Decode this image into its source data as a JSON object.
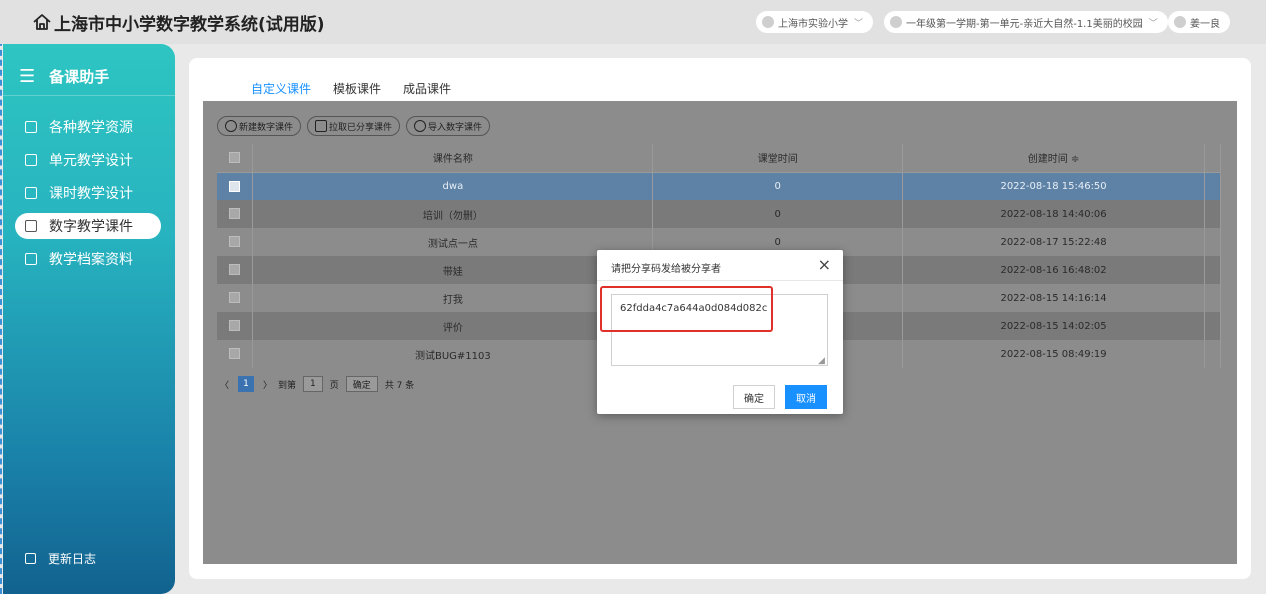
{
  "header": {
    "app_title": "上海市中小学数字教学系统(试用版)",
    "school": "上海市实验小学",
    "course": "一年级第一学期-第一单元-亲近大自然-1.1美丽的校园",
    "user": "姜一良"
  },
  "sidebar": {
    "title": "备课助手",
    "items": [
      {
        "label": "各种教学资源",
        "icon": "resource-icon"
      },
      {
        "label": "单元教学设计",
        "icon": "unit-icon"
      },
      {
        "label": "课时教学设计",
        "icon": "lesson-icon"
      },
      {
        "label": "数字教学课件",
        "icon": "courseware-icon",
        "active": true
      },
      {
        "label": "教学档案资料",
        "icon": "archive-icon"
      }
    ],
    "footer": "更新日志"
  },
  "tabs": [
    {
      "label": "自定义课件",
      "active": true
    },
    {
      "label": "模板课件"
    },
    {
      "label": "成品课件"
    }
  ],
  "toolbar": {
    "new_label": "新建数字课件",
    "pull_label": "拉取已分享课件",
    "import_label": "导入数字课件"
  },
  "table": {
    "headers": [
      "课件名称",
      "课堂时间",
      "创建时间 ≑"
    ],
    "rows": [
      {
        "name": "dwa",
        "time": "0",
        "created": "2022-08-18 15:46:50"
      },
      {
        "name": "培训（勿删）",
        "time": "0",
        "created": "2022-08-18 14:40:06"
      },
      {
        "name": "测试点一点",
        "time": "0",
        "created": "2022-08-17 15:22:48"
      },
      {
        "name": "带娃",
        "time": "",
        "created": "2022-08-16 16:48:02"
      },
      {
        "name": "打我",
        "time": "",
        "created": "2022-08-15 14:16:14"
      },
      {
        "name": "评价",
        "time": "",
        "created": "2022-08-15 14:02:05"
      },
      {
        "name": "测试BUG#1103",
        "time": "",
        "created": "2022-08-15 08:49:19"
      }
    ]
  },
  "pager": {
    "prev": "〈",
    "current": "1",
    "next": "〉",
    "goto_label": "到第",
    "page_value": "1",
    "page_unit": "页",
    "confirm": "确定",
    "total": "共 7 条"
  },
  "modal": {
    "title": "请把分享码发给被分享者",
    "close": "×",
    "code": "62fdda4c7a644a0d084d082c",
    "ok": "确定",
    "cancel": "取消"
  },
  "colors": {
    "accent": "#1890ff",
    "highlight": "#e0302a",
    "selected_row": "#5d82a6"
  }
}
